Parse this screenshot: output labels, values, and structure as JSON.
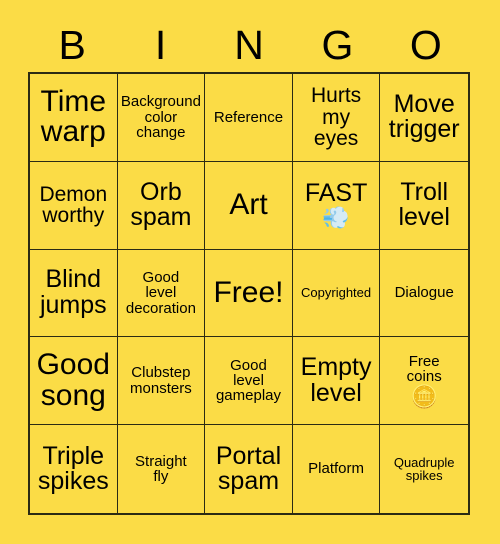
{
  "card": {
    "background_color": "#fbdc46",
    "cell_color": "#fbdc46",
    "line_color": "#2b2b14",
    "text_color": "#000000",
    "header": {
      "letters": [
        "B",
        "I",
        "N",
        "G",
        "O"
      ]
    },
    "rows": [
      [
        {
          "label": "Time\nwarp",
          "size": "xl",
          "emoji": ""
        },
        {
          "label": "Background\ncolor\nchange",
          "size": "sm",
          "emoji": ""
        },
        {
          "label": "Reference",
          "size": "sm",
          "emoji": ""
        },
        {
          "label": "Hurts\nmy\neyes",
          "size": "md",
          "emoji": ""
        },
        {
          "label": "Move\ntrigger",
          "size": "lg",
          "emoji": ""
        }
      ],
      [
        {
          "label": "Demon\nworthy",
          "size": "md",
          "emoji": ""
        },
        {
          "label": "Orb\nspam",
          "size": "lg",
          "emoji": ""
        },
        {
          "label": "Art",
          "size": "xl",
          "emoji": ""
        },
        {
          "label": "FAST",
          "size": "lg",
          "emoji": "💨"
        },
        {
          "label": "Troll\nlevel",
          "size": "lg",
          "emoji": ""
        }
      ],
      [
        {
          "label": "Blind\njumps",
          "size": "lg",
          "emoji": ""
        },
        {
          "label": "Good\nlevel\ndecoration",
          "size": "sm",
          "emoji": ""
        },
        {
          "label": "Free!",
          "size": "xl",
          "emoji": ""
        },
        {
          "label": "Copyrighted",
          "size": "xs",
          "emoji": ""
        },
        {
          "label": "Dialogue",
          "size": "sm",
          "emoji": ""
        }
      ],
      [
        {
          "label": "Good\nsong",
          "size": "xl",
          "emoji": ""
        },
        {
          "label": "Clubstep\nmonsters",
          "size": "sm",
          "emoji": ""
        },
        {
          "label": "Good\nlevel\ngameplay",
          "size": "sm",
          "emoji": ""
        },
        {
          "label": "Empty\nlevel",
          "size": "lg",
          "emoji": ""
        },
        {
          "label": "Free\ncoins",
          "size": "sm",
          "emoji": "🪙"
        }
      ],
      [
        {
          "label": "Triple\nspikes",
          "size": "lg",
          "emoji": ""
        },
        {
          "label": "Straight\nfly",
          "size": "sm",
          "emoji": ""
        },
        {
          "label": "Portal\nspam",
          "size": "lg",
          "emoji": ""
        },
        {
          "label": "Platform",
          "size": "sm",
          "emoji": ""
        },
        {
          "label": "Quadruple\nspikes",
          "size": "xs",
          "emoji": ""
        }
      ]
    ]
  }
}
